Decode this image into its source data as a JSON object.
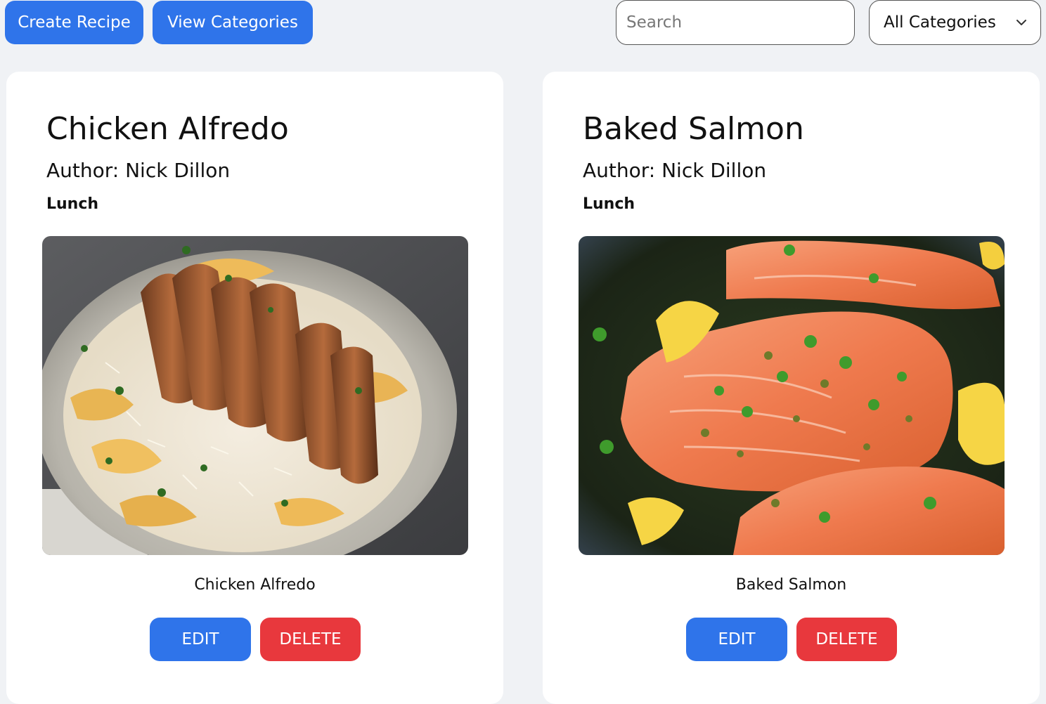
{
  "toolbar": {
    "create_label": "Create Recipe",
    "categories_label": "View Categories",
    "search_placeholder": "Search",
    "search_value": "",
    "category_filter_selected": "All Categories"
  },
  "colors": {
    "primary": "#2f74ea",
    "danger": "#e8383d",
    "background": "#f0f2f5",
    "card": "#ffffff"
  },
  "recipes": [
    {
      "title": "Chicken Alfredo",
      "author": "Author: Nick Dillon",
      "category": "Lunch",
      "image_caption": "Chicken Alfredo",
      "edit_label": "EDIT",
      "delete_label": "DELETE"
    },
    {
      "title": "Baked Salmon",
      "author": "Author: Nick Dillon",
      "category": "Lunch",
      "image_caption": "Baked Salmon",
      "edit_label": "EDIT",
      "delete_label": "DELETE"
    }
  ],
  "icons": {
    "category_dropdown": "chevron-down-icon"
  }
}
